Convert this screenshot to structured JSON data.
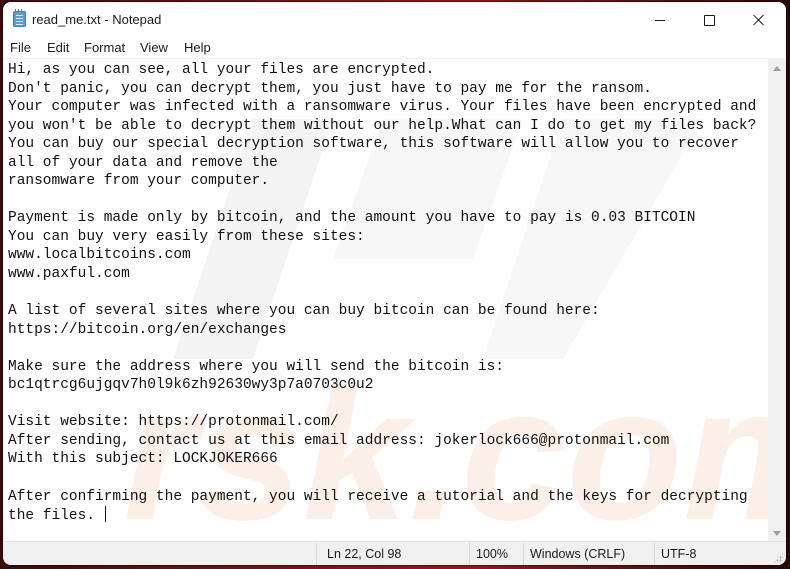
{
  "window": {
    "title": "read_me.txt - Notepad",
    "app_icon": "notepad-icon",
    "controls": {
      "minimize": "minimize-icon",
      "maximize": "maximize-icon",
      "close": "close-icon"
    }
  },
  "menubar": {
    "items": [
      {
        "label": "File"
      },
      {
        "label": "Edit"
      },
      {
        "label": "Format"
      },
      {
        "label": "View"
      },
      {
        "label": "Help"
      }
    ]
  },
  "editor": {
    "lines": [
      "Hi, as you can see, all your files are encrypted.",
      "Don't panic, you can decrypt them, you just have to pay me for the ransom.",
      "Your computer was infected with a ransomware virus. Your files have been encrypted and",
      "you won't be able to decrypt them without our help.What can I do to get my files back?",
      "You can buy our special decryption software, this software will allow you to recover",
      "all of your data and remove the",
      "ransomware from your computer.",
      "",
      "Payment is made only by bitcoin, and the amount you have to pay is 0.03 BITCOIN",
      "You can buy very easily from these sites:",
      "www.localbitcoins.com",
      "www.paxful.com",
      "",
      "A list of several sites where you can buy bitcoin can be found here:",
      "https://bitcoin.org/en/exchanges",
      "",
      "Make sure the address where you will send the bitcoin is:",
      "bc1qtrcg6ujgqv7h0l9k6zh92630wy3p7a0703c0u2",
      "",
      "Visit website: https://protonmail.com/",
      "After sending, contact us at this email address: jokerlock666@protonmail.com",
      "With this subject: LOCKJOKER666",
      "",
      "After confirming the payment, you will receive a tutorial and the keys for decrypting",
      "the files. "
    ]
  },
  "statusbar": {
    "position": "Ln 22, Col 98",
    "zoom": "100%",
    "line_ending": "Windows (CRLF)",
    "encoding": "UTF-8"
  }
}
